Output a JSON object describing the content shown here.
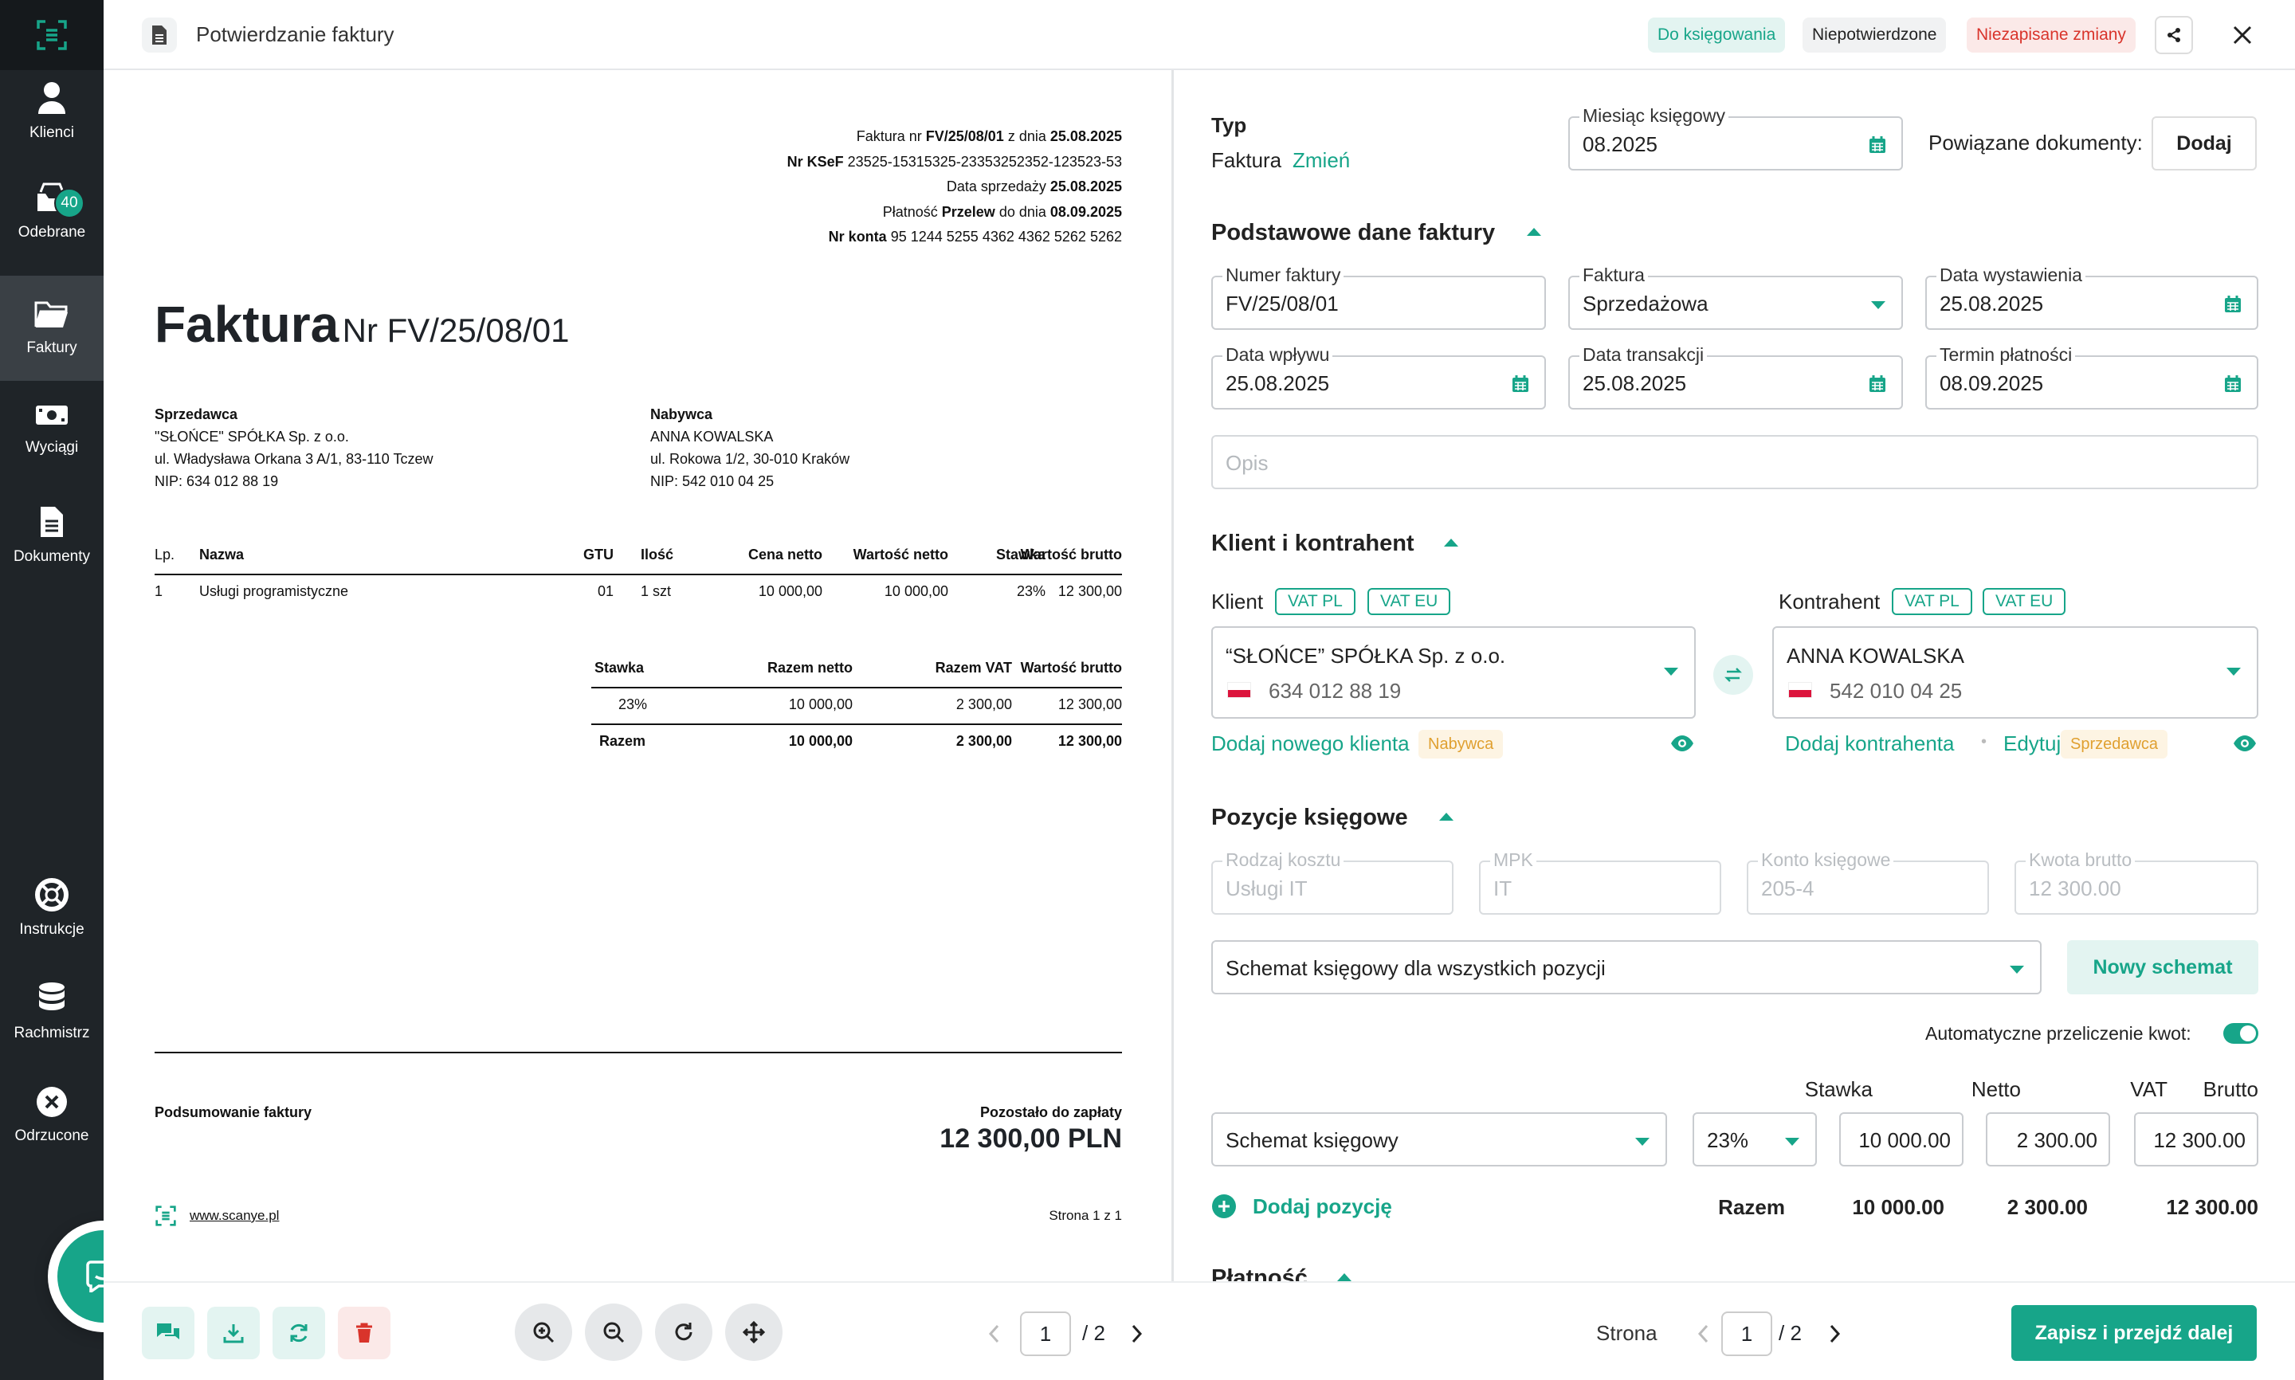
{
  "sidebar": {
    "items": [
      {
        "label": "Klienci",
        "icon": "user-icon"
      },
      {
        "label": "Odebrane",
        "icon": "inbox-icon",
        "badge": "40"
      },
      {
        "label": "Faktury",
        "icon": "folder-icon",
        "active": true
      },
      {
        "label": "Wyciągi",
        "icon": "money-icon"
      },
      {
        "label": "Dokumenty",
        "icon": "document-icon"
      },
      {
        "label": "Instrukcje",
        "icon": "lifebuoy-icon"
      },
      {
        "label": "Rachmistrz",
        "icon": "database-icon"
      },
      {
        "label": "Odrzucone",
        "icon": "x-circle-icon"
      }
    ]
  },
  "header": {
    "title": "Potwierdzanie faktury",
    "tags": {
      "ksiegowania": "Do księgowania",
      "niepotwierdzone": "Niepotwierdzone",
      "niezapisane": "Niezapisane zmiany"
    },
    "colors": {
      "teal": "#17a589",
      "red": "#d9342b",
      "tealBg": "#e3f4f1",
      "redBg": "#fbe9e8"
    }
  },
  "invoice": {
    "meta": {
      "line1_pre": "Faktura nr",
      "number": "FV/25/08/01",
      "line1_mid": "z dnia",
      "date": "25.08.2025",
      "ksef_label": "Nr KSeF",
      "ksef": "23525-15315325-23353252352-123523-53",
      "sale_label": "Data sprzedaży",
      "sale_date": "25.08.2025",
      "payment_label": "Płatność",
      "payment_method": "Przelew",
      "payment_mid": "do dnia",
      "payment_date": "08.09.2025",
      "account_label": "Nr konta",
      "account": "95 1244 5255 4362 4362 5262 5262"
    },
    "heading": "Faktura",
    "heading_nr": "Nr FV/25/08/01",
    "seller": {
      "label": "Sprzedawca",
      "name": "\"SŁOŃCE\" SPÓŁKA Sp. z o.o.",
      "address": "ul. Władysława Orkana 3 A/1, 83-110 Tczew",
      "nip": "NIP: 634 012 88 19"
    },
    "buyer": {
      "label": "Nabywca",
      "name": "ANNA KOWALSKA",
      "address": "ul. Rokowa 1/2, 30-010 Kraków",
      "nip": "NIP: 542 010 04 25"
    },
    "items_header": {
      "lp": "Lp.",
      "name": "Nazwa",
      "gtu": "GTU",
      "qty": "Ilość",
      "net_price": "Cena netto",
      "net_value": "Wartość netto",
      "rate": "Stawka",
      "gross": "Wartość brutto"
    },
    "item": {
      "lp": "1",
      "name": "Usługi programistyczne",
      "gtu": "01",
      "qty": "1 szt",
      "net_price": "10 000,00",
      "net_value": "10 000,00",
      "rate": "23%",
      "gross": "12 300,00"
    },
    "summary_header": {
      "rate": "Stawka",
      "net": "Razem netto",
      "vat": "Razem VAT",
      "gross": "Wartość brutto"
    },
    "summary_row": {
      "rate": "23%",
      "net": "10 000,00",
      "vat": "2 300,00",
      "gross": "12 300,00"
    },
    "summary_total": {
      "label": "Razem",
      "net": "10 000,00",
      "vat": "2 300,00",
      "gross": "12 300,00"
    },
    "footer": {
      "summary_label": "Podsumowanie faktury",
      "remaining_label": "Pozostało do zapłaty",
      "remaining": "12 300,00 PLN",
      "website": "www.scanye.pl",
      "page": "Strona 1 z 1"
    }
  },
  "viewer": {
    "page": "1",
    "total": "/ 2"
  },
  "form": {
    "type": {
      "label": "Typ",
      "value": "Faktura",
      "change": "Zmień"
    },
    "month": {
      "label": "Miesiąc księgowy",
      "value": "08.2025"
    },
    "related": {
      "label": "Powiązane dokumenty:",
      "button": "Dodaj"
    },
    "basic": {
      "title": "Podstawowe dane faktury",
      "number": {
        "label": "Numer faktury",
        "value": "FV/25/08/01"
      },
      "kind": {
        "label": "Faktura",
        "value": "Sprzedażowa"
      },
      "issue": {
        "label": "Data wystawienia",
        "value": "25.08.2025"
      },
      "received": {
        "label": "Data wpływu",
        "value": "25.08.2025"
      },
      "transaction": {
        "label": "Data transakcji",
        "value": "25.08.2025"
      },
      "due": {
        "label": "Termin płatności",
        "value": "08.09.2025"
      },
      "desc_placeholder": "Opis"
    },
    "parties": {
      "title": "Klient i kontrahent",
      "client": {
        "label": "Klient",
        "vatpl": "VAT PL",
        "vateu": "VAT EU",
        "name": "“SŁOŃCE” SPÓŁKA Sp. z o.o.",
        "nip": "634 012 88 19",
        "add": "Dodaj nowego klienta",
        "role": "Nabywca"
      },
      "contractor": {
        "label": "Kontrahent",
        "vatpl": "VAT PL",
        "vateu": "VAT EU",
        "name": "ANNA KOWALSKA",
        "nip": "542 010 04 25",
        "add": "Dodaj kontrahenta",
        "sep": "•",
        "edit": "Edytuj",
        "role": "Sprzedawca"
      }
    },
    "entries": {
      "title": "Pozycje księgowe",
      "cost": {
        "label": "Rodzaj kosztu",
        "value": "Usługi IT"
      },
      "mpk": {
        "label": "MPK",
        "value": "IT"
      },
      "account": {
        "label": "Konto księgowe",
        "value": "205-4"
      },
      "gross": {
        "label": "Kwota brutto",
        "value": "12 300.00"
      },
      "schema_all": "Schemat księgowy dla wszystkich pozycji",
      "new_schema": "Nowy schemat",
      "auto": "Automatyczne przeliczenie kwot:",
      "col_rate": "Stawka",
      "col_net": "Netto",
      "col_vat": "VAT",
      "col_gross": "Brutto",
      "row": {
        "schema": "Schemat księgowy",
        "rate": "23%",
        "net": "10 000.00",
        "vat": "2 300.00",
        "gross": "12 300.00"
      },
      "add_position": "Dodaj pozycję",
      "total": {
        "label": "Razem",
        "net": "10 000.00",
        "vat": "2 300.00",
        "gross": "12 300.00"
      }
    },
    "payment": {
      "title": "Płatność"
    },
    "pager": {
      "label": "Strona",
      "page": "1",
      "total": "/ 2"
    },
    "save": "Zapisz i przejdź dalej"
  }
}
